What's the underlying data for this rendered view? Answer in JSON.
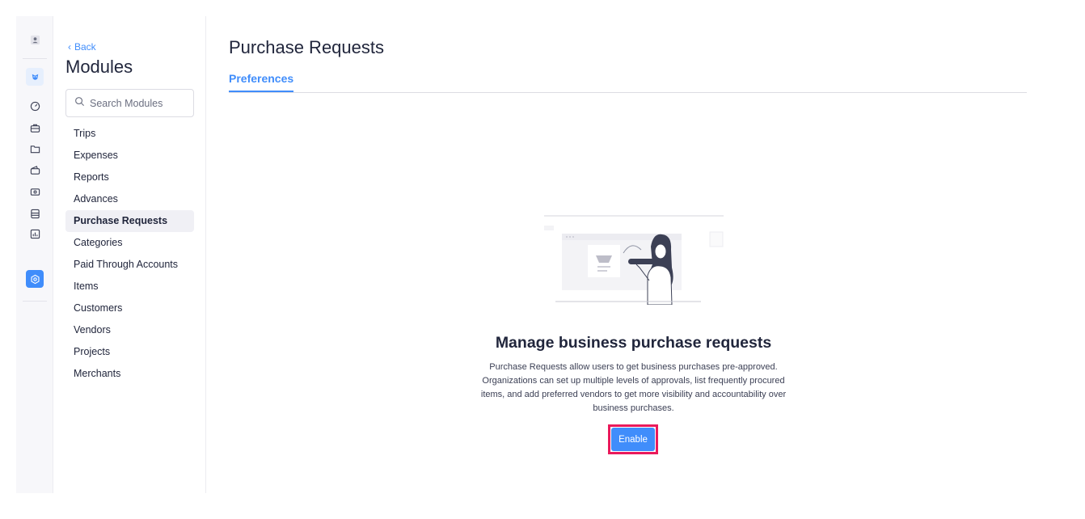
{
  "colors": {
    "accent": "#408dfb",
    "highlight": "#ea1a5b",
    "text": "#21263c"
  },
  "rail": {
    "icons": [
      "user-icon",
      "brand-logo-icon",
      "dashboard-icon",
      "trips-icon",
      "folder-icon",
      "wallet-icon",
      "cash-icon",
      "ledger-icon",
      "reports-icon",
      "settings-icon"
    ],
    "active": "settings-icon"
  },
  "modules": {
    "back_label": "Back",
    "title": "Modules",
    "search_placeholder": "Search Modules",
    "items": [
      {
        "label": "Trips"
      },
      {
        "label": "Expenses"
      },
      {
        "label": "Reports"
      },
      {
        "label": "Advances"
      },
      {
        "label": "Purchase Requests",
        "active": true
      },
      {
        "label": "Categories"
      },
      {
        "label": "Paid Through Accounts"
      },
      {
        "label": "Items"
      },
      {
        "label": "Customers"
      },
      {
        "label": "Vendors"
      },
      {
        "label": "Projects"
      },
      {
        "label": "Merchants"
      }
    ]
  },
  "main": {
    "title": "Purchase Requests",
    "tab": "Preferences",
    "empty_state": {
      "heading": "Manage business purchase requests",
      "description": "Purchase Requests allow users to get business purchases pre-approved. Organizations can set up multiple levels of approvals, list frequently procured items, and add preferred vendors to get more visibility and accountability over business purchases.",
      "enable_label": "Enable"
    }
  }
}
